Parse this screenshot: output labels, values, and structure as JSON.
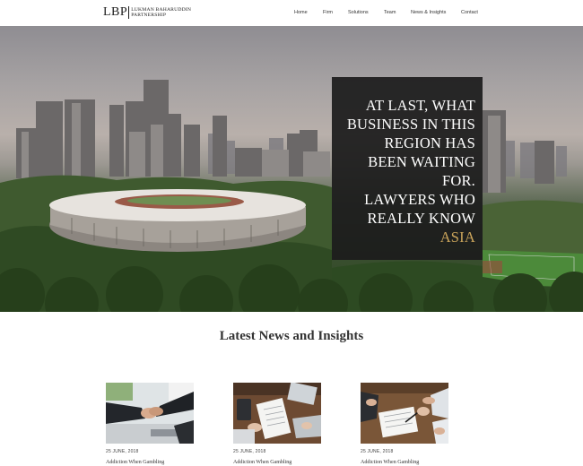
{
  "header": {
    "logo_mark": "LBP",
    "logo_line1": "LUKMAN BAHARUDDIN",
    "logo_line2": "PARTNERSHIP",
    "nav": [
      {
        "label": "Home"
      },
      {
        "label": "Firm"
      },
      {
        "label": "Solutions"
      },
      {
        "label": "Team"
      },
      {
        "label": "News & Insights"
      },
      {
        "label": "Contact"
      }
    ]
  },
  "hero": {
    "lines": [
      "AT LAST, WHAT",
      "BUSINESS IN THIS",
      "REGION HAS",
      "BEEN WAITING",
      "FOR.",
      "LAWYERS WHO",
      "REALLY KNOW"
    ],
    "accent": "ASIA",
    "accent_color": "#c9a35a"
  },
  "news": {
    "title": "Latest News and Insights",
    "cards": [
      {
        "date": "25 JUNE, 2018",
        "title": "Addiction When Gambling"
      },
      {
        "date": "25 JUNE, 2018",
        "title": "Addiction When Gambling"
      },
      {
        "date": "25 JUNE, 2018",
        "title": "Addiction When Gambling"
      }
    ]
  }
}
